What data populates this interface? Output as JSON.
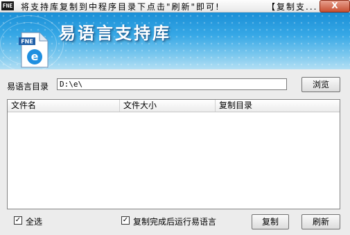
{
  "window": {
    "icon_label": "FNE",
    "title": "将支持库复制到中程序目录下点击\"刷新\"即可!",
    "title_right": "【复制支...",
    "close_label": "X"
  },
  "banner": {
    "title": "易语言支持库",
    "doc_icon_label": "FNE",
    "doc_icon_letter": "e"
  },
  "dir": {
    "label": "易语言目录",
    "value": "D:\\e\\"
  },
  "buttons": {
    "browse": "浏览",
    "copy": "复制",
    "refresh": "刷新"
  },
  "list": {
    "columns": [
      "文件名",
      "文件大小",
      "复制目录"
    ],
    "rows": []
  },
  "options": {
    "select_all": {
      "label": "全选",
      "checked": true
    },
    "run_after_copy": {
      "label": "复制完成后运行易语言",
      "checked": true
    }
  },
  "colors": {
    "banner_top": "#1a8fd6",
    "banner_bottom": "#b3dff4",
    "close_button": "#c75032"
  }
}
